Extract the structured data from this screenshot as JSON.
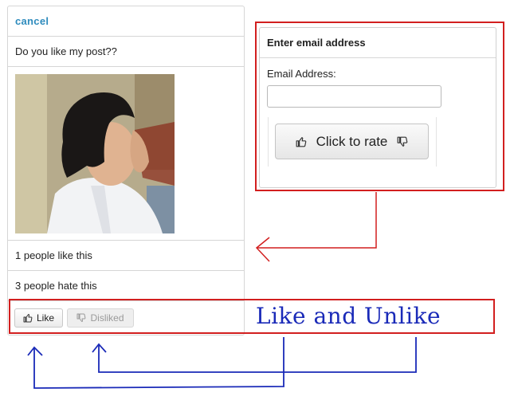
{
  "post_card": {
    "cancel_label": "cancel",
    "question": "Do you like my post??",
    "photo_icon": "user-photo",
    "likes_text": "1 people like this",
    "hates_text": "3 people hate this",
    "like_button": {
      "label": "Like",
      "icon": "thumbs-up-icon"
    },
    "dislike_button": {
      "label": "Disliked",
      "icon": "thumbs-down-icon"
    }
  },
  "email_panel": {
    "title": "Enter email address",
    "field_label": "Email Address:",
    "field_value": "",
    "rate_button": {
      "label": "Click to rate",
      "left_icon": "thumbs-up-icon",
      "right_icon": "thumbs-down-icon"
    }
  },
  "annotation": {
    "label": "Like and Unlike",
    "box_color": "#d21f1f",
    "arrow_color": "#1a2ab8"
  }
}
